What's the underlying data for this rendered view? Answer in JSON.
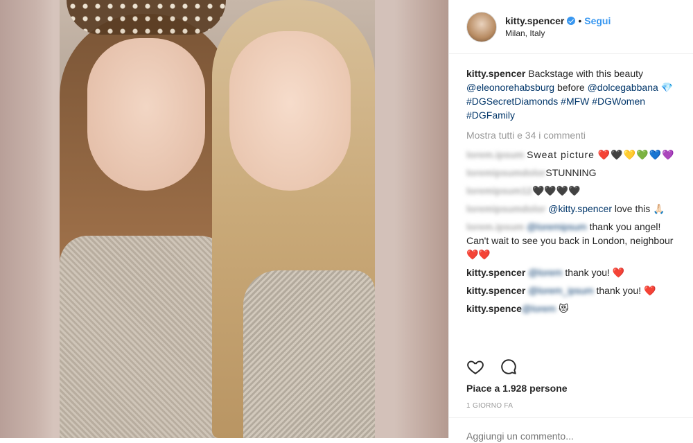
{
  "photo": {
    "alt": ""
  },
  "header": {
    "username": "kitty.spencer",
    "dot": "•",
    "follow_label": "Segui",
    "location": "Milan, Italy"
  },
  "caption": {
    "username": "kitty.spencer",
    "text1": "Backstage with this beauty",
    "mention1": "@eleonorehabsburg",
    "text2": "before",
    "mention2": "@dolcegabbana",
    "emoji1": "💎",
    "hashtags1": "#DGSecretDiamonds",
    "hashtags2": "#MFW #DGWomen #DGFamily"
  },
  "more_comments": "Mostra tutti e 34 i commenti",
  "comments": [
    {
      "user": "",
      "text": "Sweat picture ❤️🖤💛💚💙💜"
    },
    {
      "user": "",
      "text": "STUNNING"
    },
    {
      "user": "",
      "text": "🖤🖤🖤🖤"
    },
    {
      "user": "",
      "mention": "@kitty.spencer",
      "text": "love this",
      "extra": "🙏🏻"
    },
    {
      "user": "",
      "text": "thank you angel! Can't wait to see you back in London, neighbour ❤️❤️"
    },
    {
      "user": "kitty.spencer",
      "text": "thank you! ❤️"
    },
    {
      "user": "kitty.spencer",
      "text": "thank you! ❤️"
    },
    {
      "user": "kitty.spence",
      "text": "😻"
    }
  ],
  "likes": "Piace a 1.928 persone",
  "time": "1 GIORNO FA",
  "add_comment_placeholder": "Aggiungi un commento..."
}
